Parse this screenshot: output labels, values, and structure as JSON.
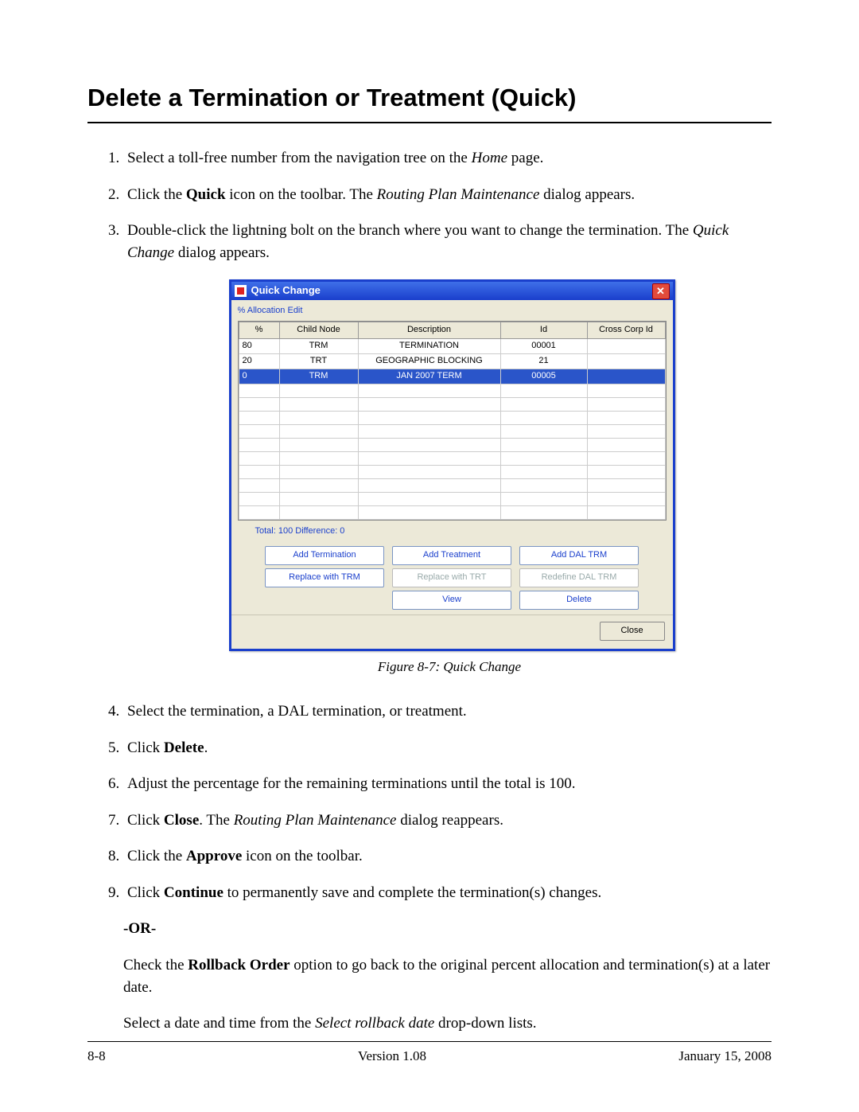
{
  "heading": "Delete a Termination or Treatment (Quick)",
  "steps": {
    "s1": {
      "pre": "Select a toll-free number from the navigation tree on the ",
      "em": "Home",
      "post": " page."
    },
    "s2": {
      "pre": "Click the ",
      "b": "Quick",
      "mid": " icon on the toolbar. The ",
      "em": "Routing Plan Maintenance",
      "post": " dialog appears."
    },
    "s3": {
      "pre": "Double-click the lightning bolt on the branch where you want to change the termination. The ",
      "em": "Quick Change",
      "post": " dialog appears."
    },
    "s4": "Select the termination, a DAL termination, or treatment.",
    "s5": {
      "pre": "Click ",
      "b": "Delete",
      "post": "."
    },
    "s6": "Adjust the percentage for the remaining terminations until the total is 100.",
    "s7": {
      "pre": "Click ",
      "b": "Close",
      "mid": ". The ",
      "em": "Routing Plan Maintenance",
      "post": " dialog reappears."
    },
    "s8": {
      "pre": "Click the ",
      "b": "Approve",
      "post": " icon on the toolbar."
    },
    "s9": {
      "pre": "Click ",
      "b": "Continue",
      "post": " to permanently save and complete the termination(s) changes."
    }
  },
  "or_label": "-OR-",
  "or_para": {
    "pre": "Check the ",
    "b": "Rollback Order",
    "post": " option to go back to the original percent allocation and termination(s) at a later date."
  },
  "rollback_para": {
    "pre": "Select a date and time from the ",
    "em": "Select rollback date",
    "post": " drop-down lists."
  },
  "figure_caption": "Figure 8-7:   Quick Change",
  "dialog": {
    "title": "Quick Change",
    "group": "% Allocation Edit",
    "columns": [
      "%",
      "Child Node",
      "Description",
      "Id",
      "Cross Corp Id"
    ],
    "rows": [
      {
        "pct": "80",
        "node": "TRM",
        "desc": "TERMINATION",
        "id": "00001",
        "cc": ""
      },
      {
        "pct": "20",
        "node": "TRT",
        "desc": "GEOGRAPHIC BLOCKING",
        "id": "21",
        "cc": ""
      },
      {
        "pct": "0",
        "node": "TRM",
        "desc": "JAN 2007 TERM",
        "id": "00005",
        "cc": "",
        "selected": true
      }
    ],
    "totals": "Total: 100 Difference: 0",
    "buttons": {
      "add_term": "Add Termination",
      "add_treat": "Add Treatment",
      "add_dal": "Add DAL TRM",
      "rep_trm": "Replace with TRM",
      "rep_trt": "Replace with TRT",
      "redef": "Redefine DAL TRM",
      "view": "View",
      "delete": "Delete"
    },
    "close": "Close"
  },
  "footer": {
    "left": "8-8",
    "center": "Version 1.08",
    "right": "January 15, 2008"
  }
}
